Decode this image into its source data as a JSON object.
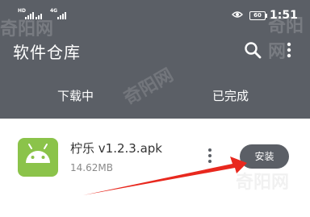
{
  "status_bar": {
    "time": "1:51",
    "battery": "60",
    "sim_tag": "HD",
    "network_type": "4G",
    "icons": [
      "signal-icon",
      "signal-icon",
      "eye-icon",
      "battery-icon"
    ]
  },
  "app_bar": {
    "title": "软件仓库",
    "actions": [
      "search-icon",
      "more-vert-icon"
    ]
  },
  "tabs": [
    {
      "label": "下载中"
    },
    {
      "label": "已完成"
    }
  ],
  "download_item": {
    "name": "柠乐 v1.2.3.apk",
    "size": "14.62MB",
    "install_label": "安装",
    "icon": "android-icon"
  },
  "watermark": "奇阳网",
  "colors": {
    "header_bg": "#5b5f66",
    "app_icon_bg": "#8bc34a",
    "install_bg": "#5b5f66",
    "arrow": "#e8281e"
  }
}
